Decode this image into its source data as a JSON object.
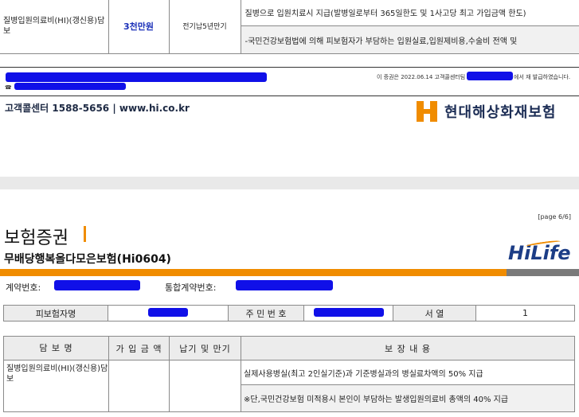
{
  "sheet1": {
    "row": {
      "name": "질병입원의료비(HI)(갱신용)담보",
      "amount": "3천만원",
      "term": "전기납5년만기",
      "desc1": "질병으로 입원치료시 지급(발병일로부터 365일한도 및 1사고당 최고 가입금액 한도)",
      "desc2": "-국민건강보험법에 의해 피보험자가 부담하는 입원실료,입원제비용,수술비 전액 및"
    },
    "issue_prefix": "이 증권은 2022.06.14 고객콜센터팀",
    "issue_suffix": "에서 재 발급하였습니다.",
    "phone_mark": "☎",
    "call_center": "고객콜센터 1588-5656 | www.hi.co.kr",
    "company": "현대해상화재보험"
  },
  "sheet2": {
    "page_no": "[page 6/6]",
    "title": "보험증권",
    "product": "무배당행복올다모은보험(Hi0604)",
    "brand": "HiLife",
    "contract_no_label": "계약번호:",
    "integrated_no_label": "통합계약번호:",
    "insured": {
      "name_label": "피보험자명",
      "rrn_label": "주 민 번 호",
      "order_label": "서 열",
      "order_value": "1"
    },
    "coverage_headers": [
      "담 보 명",
      "가 입 금 액",
      "납기 및 만기",
      "보 장 내 용"
    ],
    "row": {
      "name": "질병입원의료비(HI)(갱신용)담보",
      "desc1": "실제사용병실(최고 2인실기준)과 기준병실과의 병실료차액의 50% 지급",
      "desc2": "※단,국민건강보험 미적용시 본인이 부담하는 발생입원의료비 총액의 40% 지급"
    }
  },
  "colors": {
    "accent_orange": "#f08c00",
    "navy": "#1c2d55",
    "redaction": "#1010e8"
  }
}
